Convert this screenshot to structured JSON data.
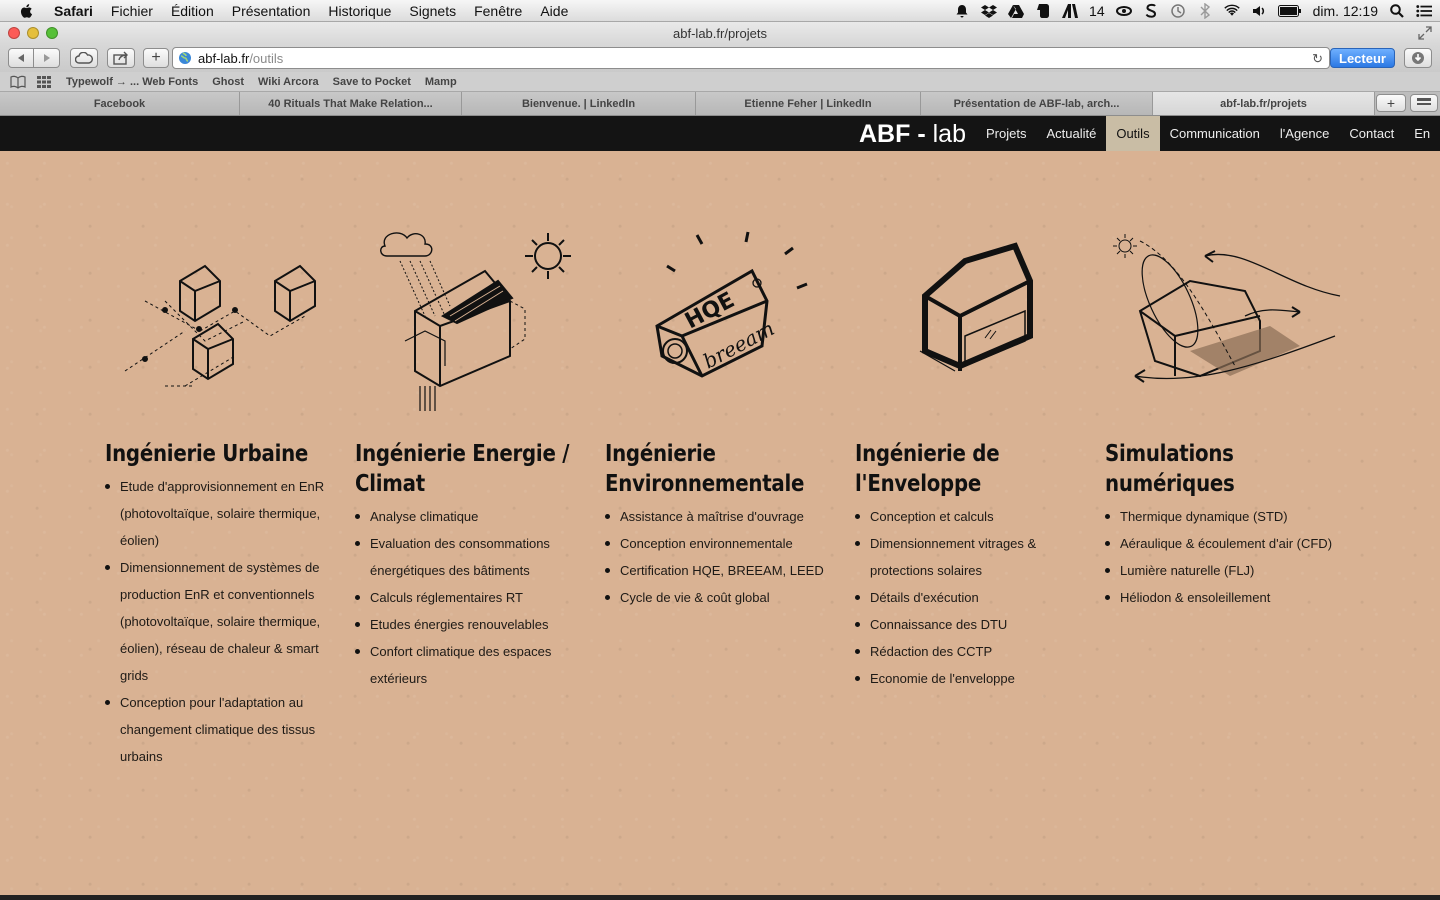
{
  "menubar": {
    "app": "Safari",
    "items": [
      "Fichier",
      "Édition",
      "Présentation",
      "Historique",
      "Signets",
      "Fenêtre",
      "Aide"
    ],
    "status": {
      "badge_count": "14",
      "clock": "dim. 12:19"
    }
  },
  "window": {
    "title": "abf-lab.fr/projets"
  },
  "toolbar": {
    "url_host": "abf-lab.fr",
    "url_path": "/outils",
    "reader_label": "Lecteur"
  },
  "bookmarks": [
    "Typewolf → ... Web Fonts",
    "Ghost",
    "Wiki Arcora",
    "Save to Pocket",
    "Mamp"
  ],
  "tabs": [
    {
      "label": "Facebook",
      "active": false
    },
    {
      "label": "40 Rituals That Make Relation...",
      "active": false
    },
    {
      "label": "Bienvenue. | LinkedIn",
      "active": false
    },
    {
      "label": "Etienne Feher | LinkedIn",
      "active": false
    },
    {
      "label": "Présentation de ABF-lab, arch...",
      "active": false
    },
    {
      "label": "abf-lab.fr/projets",
      "active": true
    }
  ],
  "site": {
    "logo_bold": "ABF - ",
    "logo_light": "lab",
    "nav": [
      {
        "label": "Projets",
        "active": false
      },
      {
        "label": "Actualité",
        "active": false
      },
      {
        "label": "Outils",
        "active": true
      },
      {
        "label": "Communication",
        "active": false
      },
      {
        "label": "l'Agence",
        "active": false
      },
      {
        "label": "Contact",
        "active": false
      },
      {
        "label": "En",
        "active": false
      }
    ]
  },
  "columns": [
    {
      "title": "Ingénierie Urbaine",
      "icon": "urban-houses-icon",
      "items": [
        "Etude d'approvisionnement en EnR (photovoltaïque, solaire thermique, éolien)",
        "Dimensionnement de systèmes de production EnR et conventionnels (photovoltaïque, solaire thermique, éolien), réseau de chaleur & smart grids",
        "Conception pour l'adaptation au changement climatique des tissus urbains"
      ]
    },
    {
      "title": "Ingénierie Energie / Climat",
      "icon": "solar-house-icon",
      "items": [
        "Analyse climatique",
        "Evaluation des consommations énergétiques des bâtiments",
        "Calculs réglementaires RT",
        "Etudes énergies renouvelables",
        "Confort climatique des espaces extérieurs"
      ]
    },
    {
      "title": "Ingénierie Environnementale",
      "icon": "hqe-breeam-house-icon",
      "badge_hqe": "HQE",
      "badge_breeam": "breeam",
      "items": [
        "Assistance à maîtrise d'ouvrage",
        "Conception environnementale",
        "Certification HQE, BREEAM, LEED",
        "Cycle de vie & coût global"
      ]
    },
    {
      "title": "Ingénierie de l'Enveloppe",
      "icon": "envelope-house-icon",
      "items": [
        "Conception et calculs",
        "Dimensionnement vitrages & protections solaires",
        "Détails d'exécution",
        "Connaissance des DTU",
        "Rédaction des CCTP",
        "Economie de l'enveloppe"
      ]
    },
    {
      "title": "Simulations numériques",
      "icon": "simulation-house-icon",
      "items": [
        "Thermique dynamique (STD)",
        "Aéraulique & écoulement d'air (CFD)",
        "Lumière naturelle (FLJ)",
        "Héliodon & ensoleillement"
      ]
    }
  ]
}
